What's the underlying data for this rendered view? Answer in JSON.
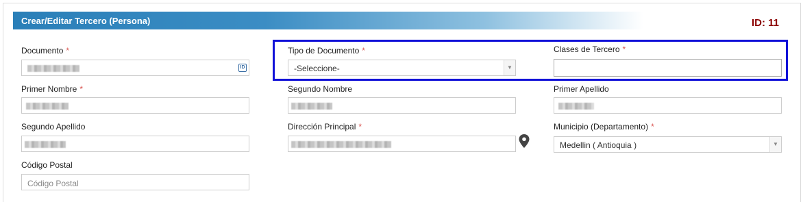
{
  "header": {
    "title": "Crear/Editar Tercero (Persona)",
    "id_label": "ID: 11"
  },
  "fields": {
    "documento": {
      "label": "Documento",
      "required": "*"
    },
    "tipo_documento": {
      "label": "Tipo de Documento",
      "required": "*",
      "value": "-Seleccione-"
    },
    "clases_tercero": {
      "label": "Clases de Tercero",
      "required": "*",
      "value": ""
    },
    "primer_nombre": {
      "label": "Primer Nombre",
      "required": "*"
    },
    "segundo_nombre": {
      "label": "Segundo Nombre"
    },
    "primer_apellido": {
      "label": "Primer Apellido"
    },
    "segundo_apellido": {
      "label": "Segundo Apellido"
    },
    "direccion": {
      "label": "Dirección Principal",
      "required": "*"
    },
    "municipio": {
      "label": "Municipio (Departamento)",
      "required": "*",
      "value": "Medellin ( Antioquia )"
    },
    "codigo_postal": {
      "label": "Código Postal",
      "placeholder": "Código Postal"
    }
  },
  "colors": {
    "header_blue": "#2a7fb8",
    "id_red": "#8b0000",
    "required_red": "#d9534f",
    "highlight_blue": "#1010d8"
  },
  "icons": {
    "document_icon": "id-card-icon",
    "location_icon": "map-pin-icon"
  }
}
